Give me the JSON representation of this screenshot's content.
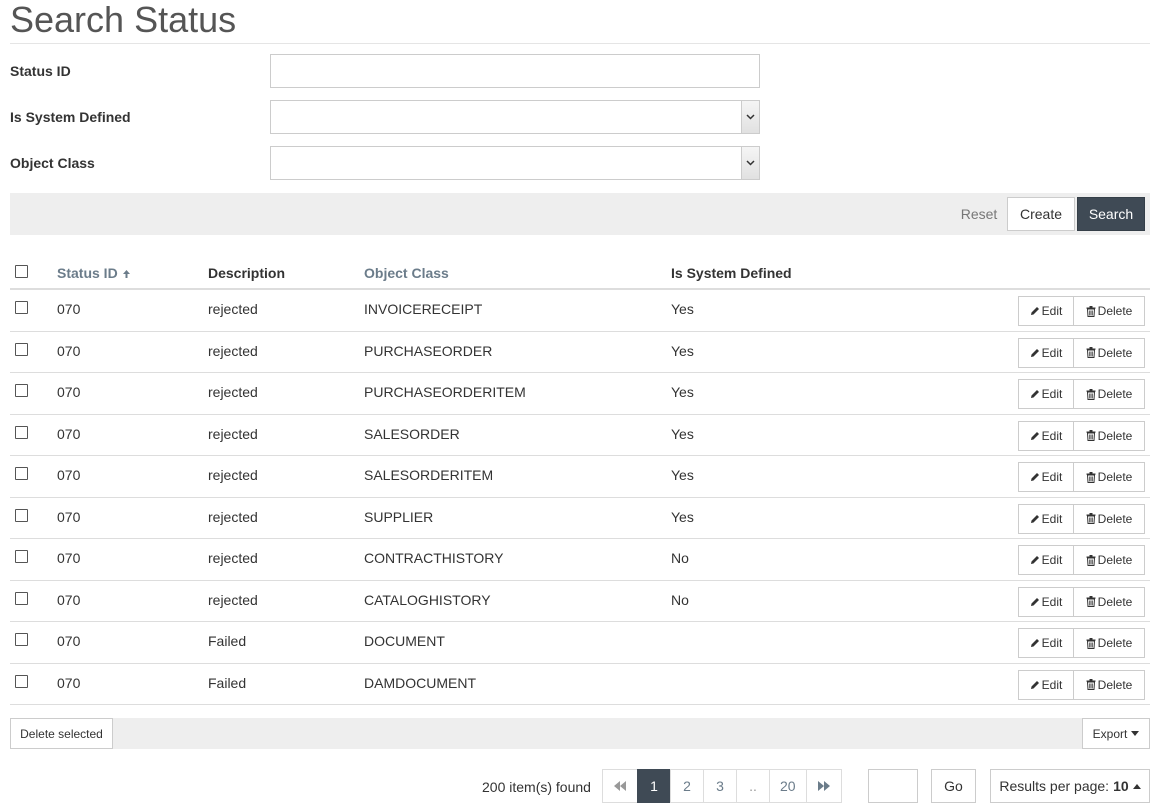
{
  "page": {
    "title": "Search Status"
  },
  "form": {
    "status_id": {
      "label": "Status ID",
      "value": ""
    },
    "is_system_defined": {
      "label": "Is System Defined",
      "value": ""
    },
    "object_class": {
      "label": "Object Class",
      "value": ""
    }
  },
  "actions": {
    "reset": "Reset",
    "create": "Create",
    "search": "Search"
  },
  "table": {
    "headers": {
      "status_id": "Status ID",
      "description": "Description",
      "object_class": "Object Class",
      "is_system_defined": "Is System Defined"
    },
    "sort_icon": "arrow-up-icon",
    "edit_label": "Edit",
    "delete_label": "Delete",
    "rows": [
      {
        "status_id": "070",
        "description": "rejected",
        "object_class": "INVOICERECEIPT",
        "is_system_defined": "Yes"
      },
      {
        "status_id": "070",
        "description": "rejected",
        "object_class": "PURCHASEORDER",
        "is_system_defined": "Yes"
      },
      {
        "status_id": "070",
        "description": "rejected",
        "object_class": "PURCHASEORDERITEM",
        "is_system_defined": "Yes"
      },
      {
        "status_id": "070",
        "description": "rejected",
        "object_class": "SALESORDER",
        "is_system_defined": "Yes"
      },
      {
        "status_id": "070",
        "description": "rejected",
        "object_class": "SALESORDERITEM",
        "is_system_defined": "Yes"
      },
      {
        "status_id": "070",
        "description": "rejected",
        "object_class": "SUPPLIER",
        "is_system_defined": "Yes"
      },
      {
        "status_id": "070",
        "description": "rejected",
        "object_class": "CONTRACTHISTORY",
        "is_system_defined": "No"
      },
      {
        "status_id": "070",
        "description": "rejected",
        "object_class": "CATALOGHISTORY",
        "is_system_defined": "No"
      },
      {
        "status_id": "070",
        "description": "Failed",
        "object_class": "DOCUMENT",
        "is_system_defined": ""
      },
      {
        "status_id": "070",
        "description": "Failed",
        "object_class": "DAMDOCUMENT",
        "is_system_defined": ""
      }
    ]
  },
  "bulk": {
    "delete_selected": "Delete selected",
    "export": "Export"
  },
  "pagination": {
    "items_found": "200 item(s) found",
    "pages": [
      "1",
      "2",
      "3",
      "..",
      "20"
    ],
    "active_page": "1",
    "go": "Go",
    "results_per_page_label": "Results per page:",
    "results_per_page_value": "10"
  },
  "colors": {
    "primary_dark": "#3f4a55",
    "link": "#6b7c8a",
    "bar_bg": "#eeeeee"
  }
}
